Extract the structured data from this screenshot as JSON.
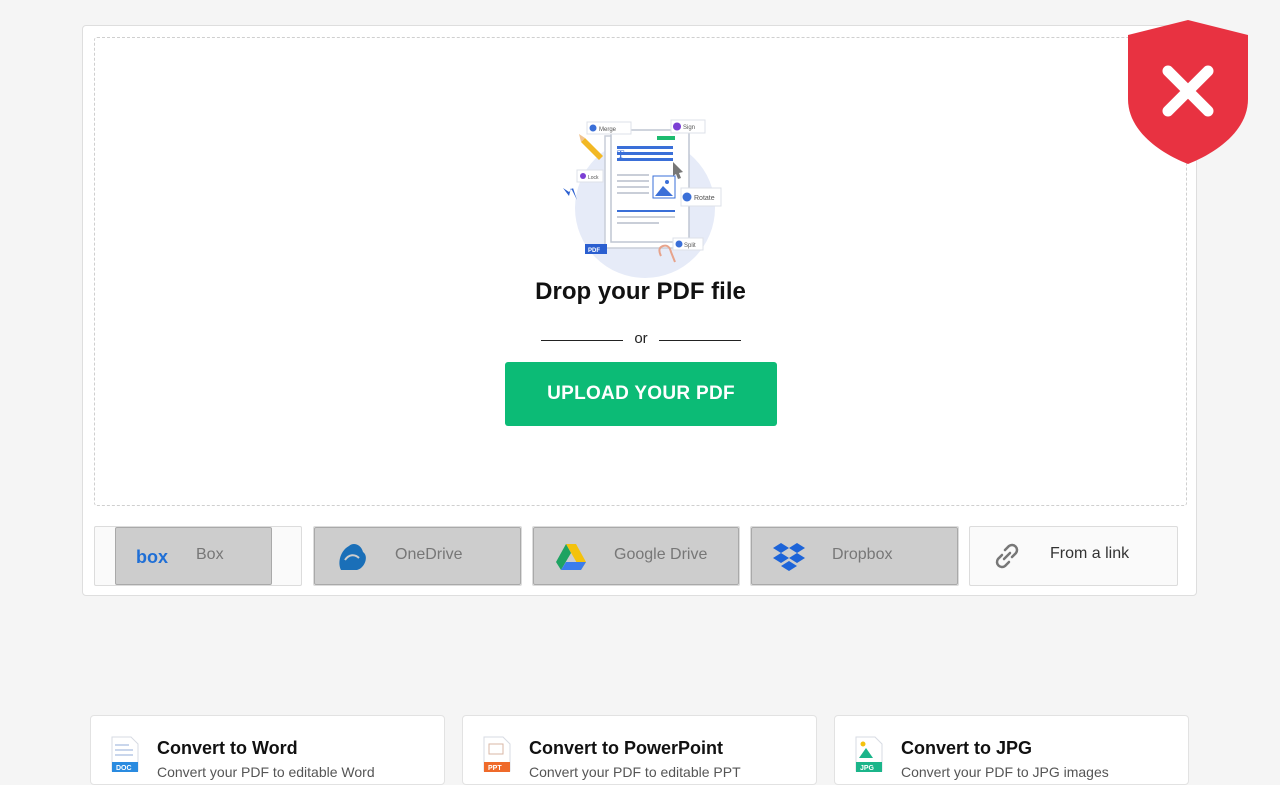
{
  "dropzone": {
    "title": "Drop your PDF file",
    "or_text": "or",
    "upload_button": "UPLOAD YOUR PDF",
    "illustration_tags": {
      "merge": "Merge",
      "sign": "Sign",
      "rotate": "Rotate",
      "split": "Split",
      "lock": "Lock",
      "pdf": "PDF"
    }
  },
  "sources": [
    {
      "label": "Box",
      "icon": "box-icon",
      "state": "disabled",
      "color": "#1f6fd6"
    },
    {
      "label": "OneDrive",
      "icon": "onedrive-icon",
      "state": "disabled",
      "color": "#1a6fb8"
    },
    {
      "label": "Google Drive",
      "icon": "google-drive-icon",
      "state": "disabled",
      "color": "#1ea362"
    },
    {
      "label": "Dropbox",
      "icon": "dropbox-icon",
      "state": "disabled",
      "color": "#1d64d8"
    },
    {
      "label": "From a link",
      "icon": "link-icon",
      "state": "enabled",
      "color": "#777777"
    }
  ],
  "status": {
    "icon": "blocked-shield-icon",
    "color": "#e83241"
  },
  "tools": [
    {
      "title": "Convert to Word",
      "subtitle": "Convert your PDF to editable Word",
      "icon": "doc-file-icon",
      "tag": "DOC",
      "color": "#2a8be0"
    },
    {
      "title": "Convert to PowerPoint",
      "subtitle": "Convert your PDF to editable PPT",
      "icon": "ppt-file-icon",
      "tag": "PPT",
      "color": "#ef6a2a"
    },
    {
      "title": "Convert to JPG",
      "subtitle": "Convert your PDF to JPG images",
      "icon": "jpg-file-icon",
      "tag": "JPG",
      "color": "#1bb58a"
    }
  ],
  "colors": {
    "accent": "#0cbb76",
    "danger": "#e83241"
  }
}
